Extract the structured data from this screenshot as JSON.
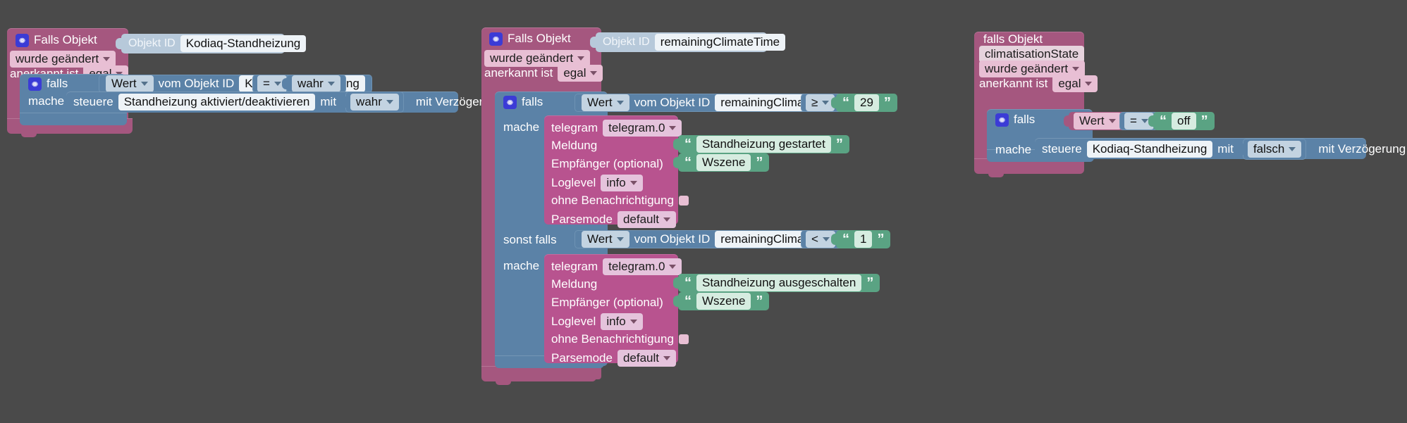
{
  "app": {
    "name": "ioBroker Blockly Script Editor",
    "canvas_background": "#4a4a4a"
  },
  "colors": {
    "event_block": "#a5577f",
    "control_block": "#5b82a7",
    "telegram_block": "#b8538f",
    "text_value_block": "#5aa383",
    "object_id_block": "#b7c9da",
    "gear_icon": "#3b3bd6"
  },
  "blocks": [
    {
      "id": "block-1",
      "name": "standheizung-trigger",
      "header": {
        "gear_icon": "gear-icon",
        "title": "Falls Objekt",
        "object_id_label": "Objekt ID",
        "object_id_value": "Kodiaq-Standheizung",
        "change_mode": "wurde geändert",
        "ack_label": "anerkannt ist",
        "ack_value": "egal"
      },
      "if_row": {
        "gear_icon": "gear-icon",
        "keyword": "falls",
        "value_kind": "Wert",
        "from_label": "vom Objekt ID",
        "object_id": "Kodiaq-Standheizung",
        "operator": "=",
        "compare_value": "wahr"
      },
      "do_row": {
        "keyword": "mache",
        "action": "steuere",
        "target": "Standheizung aktiviert/deaktivieren",
        "with_label": "mit",
        "with_value": "wahr",
        "delay_label": "mit Verzögerung",
        "delay_checked": false
      }
    },
    {
      "id": "block-2",
      "name": "remaining-climate-time-trigger",
      "header": {
        "gear_icon": "gear-icon",
        "title": "Falls Objekt",
        "object_id_label": "Objekt ID",
        "object_id_value": "remainingClimateTime",
        "change_mode": "wurde geändert",
        "ack_label": "anerkannt ist",
        "ack_value": "egal"
      },
      "if_row": {
        "gear_icon": "gear-icon",
        "keyword": "falls",
        "value_kind": "Wert",
        "from_label": "vom Objekt ID",
        "object_id": "remainingClimateTime",
        "operator": "≥",
        "compare_value": "29"
      },
      "do_row": {
        "keyword": "mache",
        "telegram_label": "telegram",
        "telegram_instance": "telegram.0",
        "message_label": "Meldung",
        "message_value": "Standheizung gestartet",
        "recipient_label": "Empfänger (optional)",
        "recipient_value": "Wszene",
        "loglevel_label": "Loglevel",
        "loglevel_value": "info",
        "silent_label": "ohne Benachrichtigung",
        "silent_checked": false,
        "parsemode_label": "Parsemode",
        "parsemode_value": "default"
      },
      "elseif_row": {
        "keyword": "sonst falls",
        "value_kind": "Wert",
        "from_label": "vom Objekt ID",
        "object_id": "remainingClimateTime",
        "operator": "<",
        "compare_value": "1"
      },
      "else_do_row": {
        "keyword": "mache",
        "telegram_label": "telegram",
        "telegram_instance": "telegram.0",
        "message_label": "Meldung",
        "message_value": "Standheizung ausgeschalten",
        "recipient_label": "Empfänger (optional)",
        "recipient_value": "Wszene",
        "loglevel_label": "Loglevel",
        "loglevel_value": "info",
        "silent_label": "ohne Benachrichtigung",
        "silent_checked": false,
        "parsemode_label": "Parsemode",
        "parsemode_value": "default"
      }
    },
    {
      "id": "block-3",
      "name": "climatisation-state-trigger",
      "header": {
        "title": "falls Objekt",
        "object_id_value": "climatisationState",
        "change_mode": "wurde geändert",
        "ack_label": "anerkannt ist",
        "ack_value": "egal"
      },
      "if_row": {
        "gear_icon": "gear-icon",
        "keyword": "falls",
        "value_kind": "Wert",
        "operator": "=",
        "compare_value": "off"
      },
      "do_row": {
        "keyword": "mache",
        "action": "steuere",
        "target": "Kodiaq-Standheizung",
        "with_label": "mit",
        "with_value": "falsch",
        "delay_label": "mit Verzögerung",
        "delay_checked": false
      }
    }
  ]
}
